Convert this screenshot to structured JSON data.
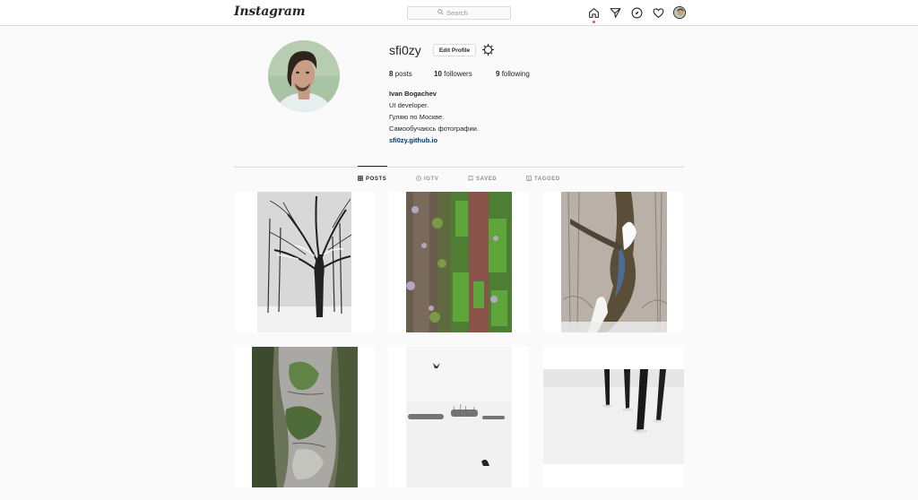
{
  "nav": {
    "logo": "Instagram",
    "search_placeholder": "Search",
    "icons": [
      "home-icon",
      "direct-icon",
      "explore-icon",
      "activity-icon",
      "profile-avatar"
    ]
  },
  "profile": {
    "username": "sfi0zy",
    "edit_label": "Edit Profile",
    "stats": {
      "posts_count": "8",
      "posts_label": "posts",
      "followers_count": "10",
      "followers_label": "followers",
      "following_count": "9",
      "following_label": "following"
    },
    "bio": {
      "full_name": "Ivan Bogachev",
      "lines": [
        "UI developer.",
        "Гуляю по Москве.",
        "Самообучаюсь фотографии."
      ],
      "website": "sfi0zy.github.io"
    }
  },
  "tabs": [
    {
      "label": "POSTS",
      "active": true
    },
    {
      "label": "IGTV",
      "active": false
    },
    {
      "label": "SAVED",
      "active": false
    },
    {
      "label": "TAGGED",
      "active": false
    }
  ],
  "posts": [
    "snowy-bare-tree",
    "mossy-tree-trunk",
    "twisted-branch-in-snow",
    "peeling-bark",
    "crows-on-snow-field",
    "dark-trunks-in-snow"
  ],
  "colors": {
    "background": "#fafafa",
    "border": "#dbdbdb",
    "text": "#262626",
    "muted": "#8e8e8e",
    "link": "#00376b",
    "notification": "#ed4956"
  }
}
